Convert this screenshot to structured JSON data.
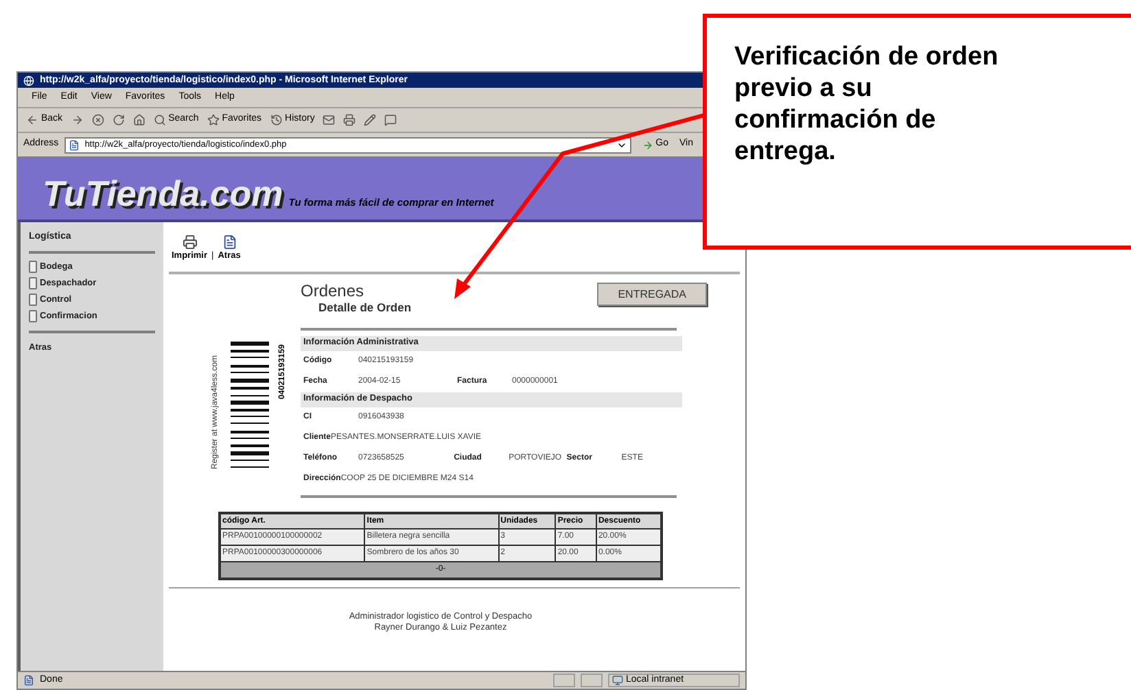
{
  "browser": {
    "title": "http://w2k_alfa/proyecto/tienda/logistico/index0.php - Microsoft Internet Explorer",
    "menu": [
      "File",
      "Edit",
      "View",
      "Favorites",
      "Tools",
      "Help"
    ],
    "toolbar": [
      {
        "kind": "back",
        "label": "Back"
      },
      {
        "kind": "forward"
      },
      {
        "kind": "stop"
      },
      {
        "kind": "refresh"
      },
      {
        "kind": "home"
      },
      {
        "kind": "search",
        "label": "Search"
      },
      {
        "kind": "favorites",
        "label": "Favorites"
      },
      {
        "kind": "history",
        "label": "History"
      },
      {
        "kind": "mail"
      },
      {
        "kind": "print"
      },
      {
        "kind": "edit"
      },
      {
        "kind": "discuss"
      }
    ],
    "address_label": "Address",
    "address": "http://w2k_alfa/proyecto/tienda/logistico/index0.php",
    "go": "Go",
    "links": "Vin",
    "status": "Done",
    "zone": "Local intranet"
  },
  "site": {
    "logo": "TuTienda.com",
    "tagline": "Tu forma más fácil de comprar en Internet"
  },
  "sidebar": {
    "title": "Logística",
    "items": [
      "Bodega",
      "Despachador",
      "Control",
      "Confirmacion"
    ],
    "back": "Atras"
  },
  "page_toolbar": {
    "print": "Imprimir",
    "separator": "|",
    "back": "Atras"
  },
  "order": {
    "title": "Ordenes",
    "subtitle": "Detalle de Orden",
    "action": "ENTREGADA",
    "barcode_caption": "Register at www.java4less.com",
    "barcode_number": "040215193159",
    "sections": [
      {
        "title": "Información Administrativa",
        "rows": [
          [
            {
              "label": "Código",
              "value": "040215193159"
            }
          ],
          [
            {
              "label": "Fecha",
              "value": "2004-02-15"
            },
            {
              "label": "Factura",
              "value": "0000000001"
            }
          ]
        ]
      },
      {
        "title": "Información de Despacho",
        "rows": [
          [
            {
              "label": "CI",
              "value": "0916043938"
            }
          ],
          [
            {
              "label": "Cliente",
              "value": "PESANTES.MONSERRATE.LUIS XAVIE"
            }
          ],
          [
            {
              "label": "Teléfono",
              "value": "0723658525"
            },
            {
              "label": "Ciudad",
              "value": "PORTOVIEJO"
            },
            {
              "label": "Sector",
              "value": "ESTE"
            }
          ],
          [
            {
              "label": "Dirección",
              "value": "COOP 25 DE DICIEMBRE M24 S14"
            }
          ]
        ]
      }
    ],
    "items": {
      "columns": [
        "código Art.",
        "Item",
        "Unidades",
        "Precio",
        "Descuento"
      ],
      "rows": [
        [
          "PRPA00100000100000002",
          "Billetera negra sencilla",
          "3",
          "7.00",
          "20.00%"
        ],
        [
          "PRPA00100000300000006",
          "Sombrero de los años 30",
          "2",
          "20.00",
          "0.00%"
        ]
      ],
      "footer": "-0-"
    }
  },
  "footer": [
    "Administrador logistico de Control y Despacho",
    "Rayner Durango & Luiz Pezantez"
  ],
  "callout": {
    "text": "Verificación de orden previo a su confirmación de entrega."
  }
}
